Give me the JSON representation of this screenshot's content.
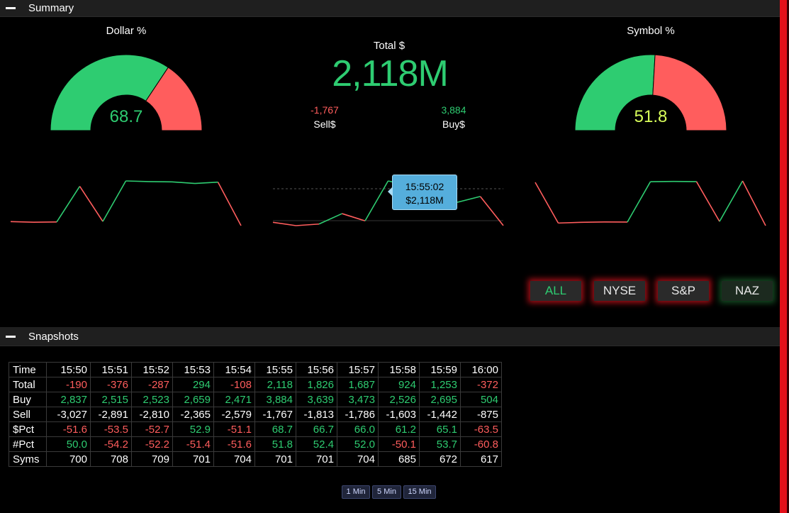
{
  "summary": {
    "header_title": "Summary",
    "dollar_gauge": {
      "title": "Dollar %",
      "value": "68.7",
      "pct": 68.7
    },
    "symbol_gauge": {
      "title": "Symbol %",
      "value": "51.8",
      "pct": 51.8
    },
    "total_label": "Total $",
    "total_value": "2,118M",
    "sell_value": "-1,767",
    "sell_label": "Sell$",
    "buy_value": "3,884",
    "buy_label": "Buy$",
    "tooltip": {
      "time": "15:55:02",
      "value": "$2,118M"
    },
    "exchanges": [
      {
        "label": "ALL",
        "active": true
      },
      {
        "label": "NYSE",
        "active": false
      },
      {
        "label": "S&P",
        "active": false
      },
      {
        "label": "NAZ",
        "active": false
      }
    ],
    "colors": {
      "green": "#2ecc71",
      "red": "#ff5d5d",
      "yellow": "#d9ff5a",
      "tooltip": "#55aedc"
    }
  },
  "chart_data": [
    {
      "type": "line",
      "x": [
        "15:50",
        "15:51",
        "15:52",
        "15:53",
        "15:54",
        "15:55",
        "15:56",
        "15:57",
        "15:58",
        "15:59",
        "16:00"
      ],
      "values": [
        -51.6,
        -53.5,
        -52.7,
        52.9,
        -51.1,
        68.7,
        66.7,
        66.0,
        61.2,
        65.1,
        -63.5
      ]
    },
    {
      "type": "line",
      "x": [
        "15:50",
        "15:51",
        "15:52",
        "15:53",
        "15:54",
        "15:55",
        "15:56",
        "15:57",
        "15:58",
        "15:59",
        "16:00"
      ],
      "values": [
        -190,
        -376,
        -287,
        294,
        -108,
        2118,
        1826,
        1687,
        924,
        1253,
        -372
      ]
    },
    {
      "type": "line",
      "x": [
        "15:50",
        "15:51",
        "15:52",
        "15:53",
        "15:54",
        "15:55",
        "15:56",
        "15:57",
        "15:58",
        "15:59",
        "16:00"
      ],
      "values": [
        50.0,
        -54.2,
        -52.2,
        -51.4,
        -51.6,
        51.8,
        52.4,
        52.0,
        -50.1,
        53.7,
        -60.8
      ]
    }
  ],
  "snapshots": {
    "header_title": "Snapshots",
    "columns": [
      "15:50",
      "15:51",
      "15:52",
      "15:53",
      "15:54",
      "15:55",
      "15:56",
      "15:57",
      "15:58",
      "15:59",
      "16:00"
    ],
    "rows": [
      {
        "label": "Time",
        "values": [
          "15:50",
          "15:51",
          "15:52",
          "15:53",
          "15:54",
          "15:55",
          "15:56",
          "15:57",
          "15:58",
          "15:59",
          "16:00"
        ],
        "colors": [
          "w",
          "w",
          "w",
          "w",
          "w",
          "w",
          "w",
          "w",
          "w",
          "w",
          "w"
        ]
      },
      {
        "label": "Total",
        "values": [
          "-190",
          "-376",
          "-287",
          "294",
          "-108",
          "2,118",
          "1,826",
          "1,687",
          "924",
          "1,253",
          "-372"
        ],
        "colors": [
          "r",
          "r",
          "r",
          "g",
          "r",
          "g",
          "g",
          "g",
          "g",
          "g",
          "r"
        ]
      },
      {
        "label": "Buy",
        "values": [
          "2,837",
          "2,515",
          "2,523",
          "2,659",
          "2,471",
          "3,884",
          "3,639",
          "3,473",
          "2,526",
          "2,695",
          "504"
        ],
        "colors": [
          "g",
          "g",
          "g",
          "g",
          "g",
          "g",
          "g",
          "g",
          "g",
          "g",
          "g"
        ]
      },
      {
        "label": "Sell",
        "values": [
          "-3,027",
          "-2,891",
          "-2,810",
          "-2,365",
          "-2,579",
          "-1,767",
          "-1,813",
          "-1,786",
          "-1,603",
          "-1,442",
          "-875"
        ],
        "colors": [
          "w",
          "w",
          "w",
          "w",
          "w",
          "w",
          "w",
          "w",
          "w",
          "w",
          "w"
        ]
      },
      {
        "label": "$Pct",
        "values": [
          "-51.6",
          "-53.5",
          "-52.7",
          "52.9",
          "-51.1",
          "68.7",
          "66.7",
          "66.0",
          "61.2",
          "65.1",
          "-63.5"
        ],
        "colors": [
          "r",
          "r",
          "r",
          "g",
          "r",
          "g",
          "g",
          "g",
          "g",
          "g",
          "r"
        ]
      },
      {
        "label": "#Pct",
        "values": [
          "50.0",
          "-54.2",
          "-52.2",
          "-51.4",
          "-51.6",
          "51.8",
          "52.4",
          "52.0",
          "-50.1",
          "53.7",
          "-60.8"
        ],
        "colors": [
          "g",
          "r",
          "r",
          "r",
          "r",
          "g",
          "g",
          "g",
          "r",
          "g",
          "r"
        ]
      },
      {
        "label": "Syms",
        "values": [
          "700",
          "708",
          "709",
          "701",
          "704",
          "701",
          "701",
          "704",
          "685",
          "672",
          "617"
        ],
        "colors": [
          "w",
          "w",
          "w",
          "w",
          "w",
          "w",
          "w",
          "w",
          "w",
          "w",
          "w"
        ]
      }
    ],
    "intervals": [
      "1 Min",
      "5 Min",
      "15 Min"
    ]
  }
}
